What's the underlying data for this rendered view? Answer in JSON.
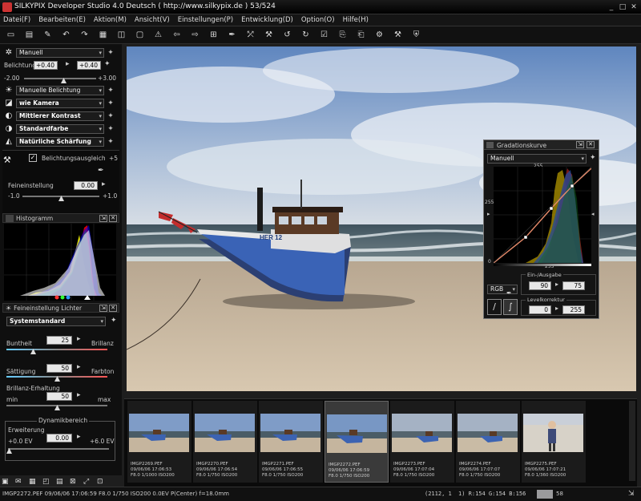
{
  "window": {
    "title": "SILKYPIX Developer Studio 4.0 Deutsch ( http://www.silkypix.de )  53/524"
  },
  "menu": [
    "Datei(F)",
    "Bearbeiten(E)",
    "Aktion(M)",
    "Ansicht(V)",
    "Einstellungen(P)",
    "Entwicklung(D)",
    "Option(O)",
    "Hilfe(H)"
  ],
  "left": {
    "preset": "Manuell",
    "exposure_label": "Belichtung",
    "exposure_val_a": "+0.40",
    "exposure_val_b": "+0.40",
    "exposure_min": "-2.00",
    "exposure_max": "+3.00",
    "manual_exposure": "Manuelle Belichtung",
    "wb": "wie Kamera",
    "contrast": "Mittlerer Kontrast",
    "color": "Standardfarbe",
    "sharp": "Natürliche Schärfung",
    "exp_comp": "Belichtungsausgleich",
    "exp_comp_val": "+5",
    "fine_label": "Feineinstellung",
    "fine_val": "0.00",
    "fine_min": "-1.0",
    "fine_max": "+1.0",
    "histogram_title": "Histogramm",
    "fine_lights_title": "Feineinstellung Lichter",
    "system_standard": "Systemstandard",
    "hue_label": "Buntheit",
    "hue_val": "25",
    "hue_right": "Brillanz",
    "sat_label": "Sättigung",
    "sat_val": "50",
    "sat_right": "Farbton",
    "bril_label": "Brillanz-Erhaltung",
    "bril_val": "50",
    "bril_min": "min",
    "bril_max": "max",
    "dyn_title": "Dynamikbereich",
    "ext_label": "Erweiterung",
    "ext_val": "0.00",
    "ext_min": "+0.0 EV",
    "ext_max": "+6.0 EV"
  },
  "gradation": {
    "title": "Gradationskurve",
    "preset": "Manuell",
    "top_val": "255",
    "left_val": "255",
    "bottom_val": "0",
    "mid_val": "255",
    "channel": "RGB",
    "io_title": "Ein-/Ausgabe",
    "in_val": "90",
    "out_val": "75",
    "level_title": "Levelkorrektur",
    "level_low": "0",
    "level_high": "255"
  },
  "thumbs": [
    {
      "name": "IMGP2269.PEF",
      "date": "09/06/06 17:06:53",
      "exp": "F8.0 1/1000 ISO200"
    },
    {
      "name": "IMGP2270.PEF",
      "date": "09/06/06 17:06:54",
      "exp": "F8.0 1/750 ISO200"
    },
    {
      "name": "IMGP2271.PEF",
      "date": "09/06/06 17:06:55",
      "exp": "F8.0 1/750 ISO200"
    },
    {
      "name": "IMGP2272.PEF",
      "date": "09/06/06 17:06:59",
      "exp": "F8.0 1/750 ISO200"
    },
    {
      "name": "IMGP2273.PEF",
      "date": "09/06/06 17:07:04",
      "exp": "F8.0 1/750 ISO200"
    },
    {
      "name": "IMGP2274.PEF",
      "date": "09/06/06 17:07:07",
      "exp": "F8.0 1/750 ISO200"
    },
    {
      "name": "IMGP2275.PEF",
      "date": "09/06/06 17:07:21",
      "exp": "F8.0 1/360 ISO200"
    }
  ],
  "boat_label": "HER 12",
  "status": {
    "info": "IMGP2272.PEF 09/06/06 17:06:59 F8.0 1/750 ISO200 0.0EV P(Center) f=18.0mm",
    "coords": "(2112, 1",
    "rgb": "1) R:154 G:154 B:156",
    "zoom": "58"
  }
}
